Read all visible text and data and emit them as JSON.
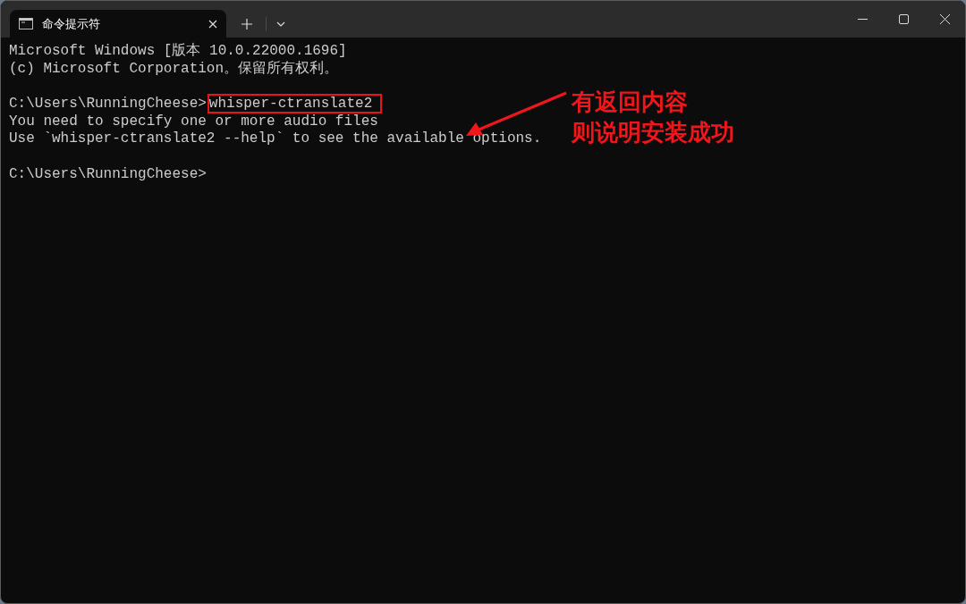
{
  "window": {
    "tab": {
      "title": "命令提示符",
      "selected": true
    }
  },
  "terminal": {
    "lines": [
      {
        "kind": "output",
        "text": "Microsoft Windows [版本 10.0.22000.1696]"
      },
      {
        "kind": "output",
        "text": "(c) Microsoft Corporation。保留所有权利。"
      },
      {
        "kind": "blank"
      },
      {
        "kind": "command",
        "prompt": "C:\\Users\\RunningCheese>",
        "command": "whisper-ctranslate2",
        "highlighted": true
      },
      {
        "kind": "output",
        "text": "You need to specify one or more audio files"
      },
      {
        "kind": "output",
        "text": "Use `whisper-ctranslate2 --help` to see the available options."
      },
      {
        "kind": "blank"
      },
      {
        "kind": "command",
        "prompt": "C:\\Users\\RunningCheese>"
      }
    ]
  },
  "annotation": {
    "lines": [
      "有返回内容",
      "则说明安装成功"
    ]
  }
}
